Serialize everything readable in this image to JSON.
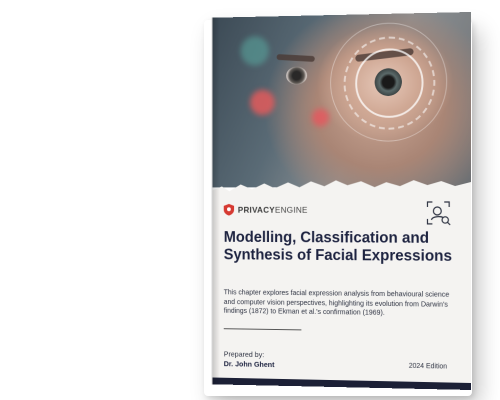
{
  "brand": {
    "name_strong": "PRIVACY",
    "name_light": "ENGINE",
    "logo_color": "#d63a32"
  },
  "icons": {
    "logo": "shield-logo-icon",
    "face_scan": "face-scan-icon"
  },
  "cover": {
    "title": "Modelling, Classification and Synthesis of Facial Expressions",
    "description": "This chapter explores facial expression analysis from behavioural science and computer vision perspectives, highlighting its evolution from Darwin's findings (1872) to Ekman et al.'s confirmation (1969).",
    "prepared_label": "Prepared by:",
    "author": "Dr. John Ghent",
    "edition": "2024 Edition"
  },
  "colors": {
    "title": "#1d2340",
    "bottom_bar": "#1c2036",
    "cover_background": "#f4f3f1"
  }
}
